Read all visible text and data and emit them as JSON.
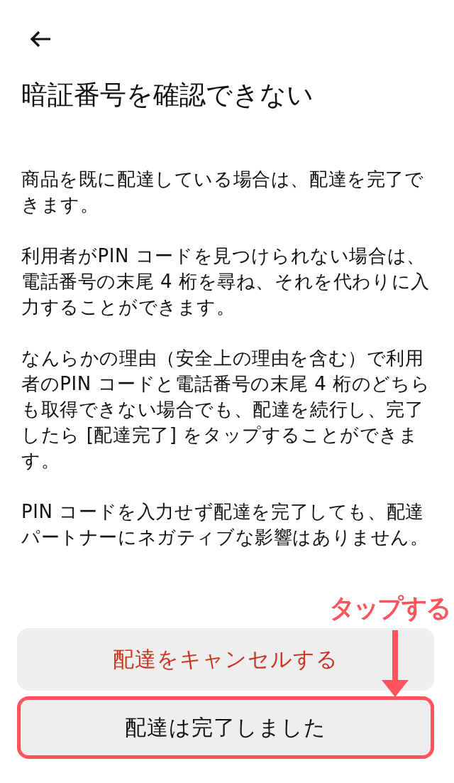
{
  "title": "暗証番号を確認できない",
  "paragraphs": [
    "商品を既に配達している場合は、配達を完了できます。",
    "利用者がPIN コードを見つけられない場合は、電話番号の末尾 4 桁を尋ね、それを代わりに入力することができます。",
    "なんらかの理由（安全上の理由を含む）で利用者のPIN コードと電話番号の末尾 4 桁のどちらも取得できない場合でも、配達を続行し、完了したら [配達完了] をタップすることができます。",
    "PIN コードを入力せず配達を完了しても、配達パートナーにネガティブな影響はありません。"
  ],
  "buttons": [
    {
      "label": "配達をキャンセルする",
      "kind": "danger",
      "highlighted": false
    },
    {
      "label": "配達は完了しました",
      "kind": "default",
      "highlighted": true
    }
  ],
  "annotation": {
    "label": "タップする"
  }
}
